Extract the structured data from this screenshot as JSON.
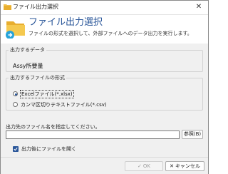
{
  "window": {
    "title": "ファイル出力選択",
    "close_glyph": "✕"
  },
  "header": {
    "title": "ファイル出力選択",
    "description": "ファイルの形式を選択して、外部ファイルへのデータ出力を実行します。",
    "icon": "folder-icon"
  },
  "data_group": {
    "legend": "出力するデータ",
    "value": "Assy所要量"
  },
  "format_group": {
    "legend": "出力するファイルの形式",
    "options": [
      {
        "label": "Excelファイル(*.xlsx)",
        "checked": true
      },
      {
        "label": "カンマ区切りテキストファイル(*.csv)",
        "checked": false
      }
    ]
  },
  "output_path": {
    "label": "出力先のファイル名を指定してください。",
    "value": "",
    "browse_label": "参照(B)"
  },
  "open_after": {
    "label": "出力後にファイルを開く",
    "checked": true
  },
  "footer": {
    "ok_icon": "✓",
    "ok_label": "OK",
    "cancel_icon": "✕",
    "cancel_label": "キャンセル"
  },
  "colors": {
    "accent": "#2b579a",
    "folder": "#f2c14e"
  }
}
